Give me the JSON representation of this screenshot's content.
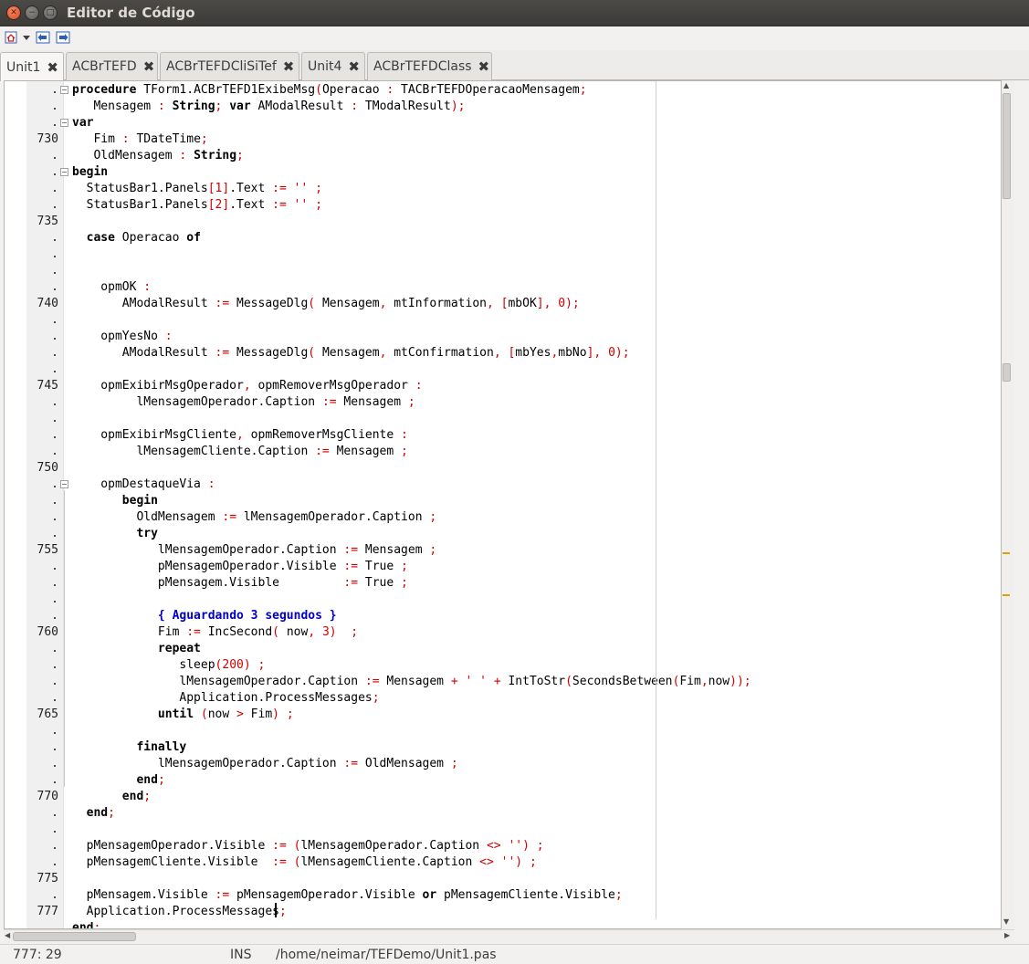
{
  "window": {
    "title": "Editor de Código"
  },
  "toolbar": {
    "icons": [
      "home-icon",
      "dropdown-arrow-icon",
      "back-icon",
      "forward-icon"
    ]
  },
  "tabs": [
    {
      "label": "Unit1",
      "active": true
    },
    {
      "label": "ACBrTEFD",
      "active": false
    },
    {
      "label": "ACBrTEFDCliSiTef",
      "active": false
    },
    {
      "label": "Unit4",
      "active": false
    },
    {
      "label": "ACBrTEFDClass",
      "active": false
    }
  ],
  "gutter": {
    "line_labels": [
      ".",
      ".",
      ".",
      "730",
      ".",
      ".",
      ".",
      ".",
      "735",
      ".",
      ".",
      ".",
      ".",
      "740",
      ".",
      ".",
      ".",
      ".",
      "745",
      ".",
      ".",
      ".",
      ".",
      "750",
      ".",
      ".",
      ".",
      ".",
      "755",
      ".",
      ".",
      ".",
      ".",
      "760",
      ".",
      ".",
      ".",
      ".",
      "765",
      ".",
      ".",
      ".",
      ".",
      "770",
      ".",
      ".",
      ".",
      ".",
      "775",
      ".",
      "777"
    ]
  },
  "code": {
    "lines": [
      [
        [
          "k",
          "procedure"
        ],
        [
          "p",
          " TForm1.ACBrTEFD1ExibeMsg"
        ],
        [
          "s",
          "("
        ],
        [
          "p",
          "Operacao "
        ],
        [
          "s",
          ":"
        ],
        [
          "p",
          " TACBrTEFDOperacaoMensagem"
        ],
        [
          "s",
          ";"
        ]
      ],
      [
        [
          "p",
          "   Mensagem "
        ],
        [
          "s",
          ":"
        ],
        [
          "p",
          " "
        ],
        [
          "k",
          "String"
        ],
        [
          "s",
          ";"
        ],
        [
          "p",
          " "
        ],
        [
          "k",
          "var"
        ],
        [
          "p",
          " AModalResult "
        ],
        [
          "s",
          ":"
        ],
        [
          "p",
          " TModalResult"
        ],
        [
          "s",
          ");"
        ]
      ],
      [
        [
          "k",
          "var"
        ]
      ],
      [
        [
          "p",
          "   Fim "
        ],
        [
          "s",
          ":"
        ],
        [
          "p",
          " TDateTime"
        ],
        [
          "s",
          ";"
        ]
      ],
      [
        [
          "p",
          "   OldMensagem "
        ],
        [
          "s",
          ":"
        ],
        [
          "p",
          " "
        ],
        [
          "k",
          "String"
        ],
        [
          "s",
          ";"
        ]
      ],
      [
        [
          "k",
          "begin"
        ]
      ],
      [
        [
          "p",
          "  StatusBar1.Panels"
        ],
        [
          "s",
          "["
        ],
        [
          "n",
          "1"
        ],
        [
          "s",
          "]"
        ],
        [
          "p",
          ".Text "
        ],
        [
          "s",
          ":="
        ],
        [
          "p",
          " "
        ],
        [
          "s",
          "''"
        ],
        [
          "p",
          " "
        ],
        [
          "s",
          ";"
        ]
      ],
      [
        [
          "p",
          "  StatusBar1.Panels"
        ],
        [
          "s",
          "["
        ],
        [
          "n",
          "2"
        ],
        [
          "s",
          "]"
        ],
        [
          "p",
          ".Text "
        ],
        [
          "s",
          ":="
        ],
        [
          "p",
          " "
        ],
        [
          "s",
          "''"
        ],
        [
          "p",
          " "
        ],
        [
          "s",
          ";"
        ]
      ],
      [],
      [
        [
          "p",
          "  "
        ],
        [
          "k",
          "case"
        ],
        [
          "p",
          " Operacao "
        ],
        [
          "k",
          "of"
        ]
      ],
      [],
      [],
      [
        [
          "p",
          "    opmOK "
        ],
        [
          "s",
          ":"
        ]
      ],
      [
        [
          "p",
          "       AModalResult "
        ],
        [
          "s",
          ":="
        ],
        [
          "p",
          " MessageDlg"
        ],
        [
          "s",
          "("
        ],
        [
          "p",
          " Mensagem"
        ],
        [
          "s",
          ","
        ],
        [
          "p",
          " mtInformation"
        ],
        [
          "s",
          ","
        ],
        [
          "p",
          " "
        ],
        [
          "s",
          "["
        ],
        [
          "p",
          "mbOK"
        ],
        [
          "s",
          "],"
        ],
        [
          "p",
          " "
        ],
        [
          "n",
          "0"
        ],
        [
          "s",
          ");"
        ]
      ],
      [],
      [
        [
          "p",
          "    opmYesNo "
        ],
        [
          "s",
          ":"
        ]
      ],
      [
        [
          "p",
          "       AModalResult "
        ],
        [
          "s",
          ":="
        ],
        [
          "p",
          " MessageDlg"
        ],
        [
          "s",
          "("
        ],
        [
          "p",
          " Mensagem"
        ],
        [
          "s",
          ","
        ],
        [
          "p",
          " mtConfirmation"
        ],
        [
          "s",
          ","
        ],
        [
          "p",
          " "
        ],
        [
          "s",
          "["
        ],
        [
          "p",
          "mbYes"
        ],
        [
          "s",
          ","
        ],
        [
          "p",
          "mbNo"
        ],
        [
          "s",
          "],"
        ],
        [
          "p",
          " "
        ],
        [
          "n",
          "0"
        ],
        [
          "s",
          ");"
        ]
      ],
      [],
      [
        [
          "p",
          "    opmExibirMsgOperador"
        ],
        [
          "s",
          ","
        ],
        [
          "p",
          " opmRemoverMsgOperador "
        ],
        [
          "s",
          ":"
        ]
      ],
      [
        [
          "p",
          "         lMensagemOperador.Caption "
        ],
        [
          "s",
          ":="
        ],
        [
          "p",
          " Mensagem "
        ],
        [
          "s",
          ";"
        ]
      ],
      [],
      [
        [
          "p",
          "    opmExibirMsgCliente"
        ],
        [
          "s",
          ","
        ],
        [
          "p",
          " opmRemoverMsgCliente "
        ],
        [
          "s",
          ":"
        ]
      ],
      [
        [
          "p",
          "         lMensagemCliente.Caption "
        ],
        [
          "s",
          ":="
        ],
        [
          "p",
          " Mensagem "
        ],
        [
          "s",
          ";"
        ]
      ],
      [],
      [
        [
          "p",
          "    opmDestaqueVia "
        ],
        [
          "s",
          ":"
        ]
      ],
      [
        [
          "p",
          "       "
        ],
        [
          "k",
          "begin"
        ]
      ],
      [
        [
          "p",
          "         OldMensagem "
        ],
        [
          "s",
          ":="
        ],
        [
          "p",
          " lMensagemOperador.Caption "
        ],
        [
          "s",
          ";"
        ]
      ],
      [
        [
          "p",
          "         "
        ],
        [
          "k",
          "try"
        ]
      ],
      [
        [
          "p",
          "            lMensagemOperador.Caption "
        ],
        [
          "s",
          ":="
        ],
        [
          "p",
          " Mensagem "
        ],
        [
          "s",
          ";"
        ]
      ],
      [
        [
          "p",
          "            pMensagemOperador.Visible "
        ],
        [
          "s",
          ":="
        ],
        [
          "p",
          " True "
        ],
        [
          "s",
          ";"
        ]
      ],
      [
        [
          "p",
          "            pMensagem.Visible         "
        ],
        [
          "s",
          ":="
        ],
        [
          "p",
          " True "
        ],
        [
          "s",
          ";"
        ]
      ],
      [],
      [
        [
          "p",
          "            "
        ],
        [
          "c",
          "{ Aguardando 3 segundos }"
        ]
      ],
      [
        [
          "p",
          "            Fim "
        ],
        [
          "s",
          ":="
        ],
        [
          "p",
          " IncSecond"
        ],
        [
          "s",
          "("
        ],
        [
          "p",
          " now"
        ],
        [
          "s",
          ","
        ],
        [
          "p",
          " "
        ],
        [
          "n",
          "3"
        ],
        [
          "s",
          ")"
        ],
        [
          "p",
          "  "
        ],
        [
          "s",
          ";"
        ]
      ],
      [
        [
          "p",
          "            "
        ],
        [
          "k",
          "repeat"
        ]
      ],
      [
        [
          "p",
          "               sleep"
        ],
        [
          "s",
          "("
        ],
        [
          "n",
          "200"
        ],
        [
          "s",
          ")"
        ],
        [
          "p",
          " "
        ],
        [
          "s",
          ";"
        ]
      ],
      [
        [
          "p",
          "               lMensagemOperador.Caption "
        ],
        [
          "s",
          ":="
        ],
        [
          "p",
          " Mensagem "
        ],
        [
          "s",
          "+"
        ],
        [
          "p",
          " "
        ],
        [
          "s",
          "' '"
        ],
        [
          "p",
          " "
        ],
        [
          "s",
          "+"
        ],
        [
          "p",
          " IntToStr"
        ],
        [
          "s",
          "("
        ],
        [
          "p",
          "SecondsBetween"
        ],
        [
          "s",
          "("
        ],
        [
          "p",
          "Fim"
        ],
        [
          "s",
          ","
        ],
        [
          "p",
          "now"
        ],
        [
          "s",
          "));"
        ]
      ],
      [
        [
          "p",
          "               Application.ProcessMessages"
        ],
        [
          "s",
          ";"
        ]
      ],
      [
        [
          "p",
          "            "
        ],
        [
          "k",
          "until"
        ],
        [
          "p",
          " "
        ],
        [
          "s",
          "("
        ],
        [
          "p",
          "now "
        ],
        [
          "s",
          ">"
        ],
        [
          "p",
          " Fim"
        ],
        [
          "s",
          ")"
        ],
        [
          "p",
          " "
        ],
        [
          "s",
          ";"
        ]
      ],
      [],
      [
        [
          "p",
          "         "
        ],
        [
          "k",
          "finally"
        ]
      ],
      [
        [
          "p",
          "            lMensagemOperador.Caption "
        ],
        [
          "s",
          ":="
        ],
        [
          "p",
          " OldMensagem "
        ],
        [
          "s",
          ";"
        ]
      ],
      [
        [
          "p",
          "         "
        ],
        [
          "k",
          "end"
        ],
        [
          "s",
          ";"
        ]
      ],
      [
        [
          "p",
          "       "
        ],
        [
          "k",
          "end"
        ],
        [
          "s",
          ";"
        ]
      ],
      [
        [
          "p",
          "  "
        ],
        [
          "k",
          "end"
        ],
        [
          "s",
          ";"
        ]
      ],
      [],
      [
        [
          "p",
          "  pMensagemOperador.Visible "
        ],
        [
          "s",
          ":="
        ],
        [
          "p",
          " "
        ],
        [
          "s",
          "("
        ],
        [
          "p",
          "lMensagemOperador.Caption "
        ],
        [
          "s",
          "<>"
        ],
        [
          "p",
          " "
        ],
        [
          "s",
          "'')"
        ],
        [
          "p",
          " "
        ],
        [
          "s",
          ";"
        ]
      ],
      [
        [
          "p",
          "  pMensagemCliente.Visible  "
        ],
        [
          "s",
          ":="
        ],
        [
          "p",
          " "
        ],
        [
          "s",
          "("
        ],
        [
          "p",
          "lMensagemCliente.Caption "
        ],
        [
          "s",
          "<>"
        ],
        [
          "p",
          " "
        ],
        [
          "s",
          "'')"
        ],
        [
          "p",
          " "
        ],
        [
          "s",
          ";"
        ]
      ],
      [],
      [
        [
          "p",
          "  pMensagem.Visible "
        ],
        [
          "s",
          ":="
        ],
        [
          "p",
          " pMensagemOperador.Visible "
        ],
        [
          "k",
          "or"
        ],
        [
          "p",
          " pMensagemCliente.Visible"
        ],
        [
          "s",
          ";"
        ]
      ],
      [
        [
          "p",
          "  Application.ProcessMessages"
        ],
        [
          "s",
          ";"
        ]
      ],
      [
        [
          "k",
          "end"
        ],
        [
          "s",
          ";"
        ]
      ]
    ]
  },
  "status": {
    "position": "777: 29",
    "mode": "INS",
    "file": "/home/neimar/TEFDemo/Unit1.pas"
  }
}
